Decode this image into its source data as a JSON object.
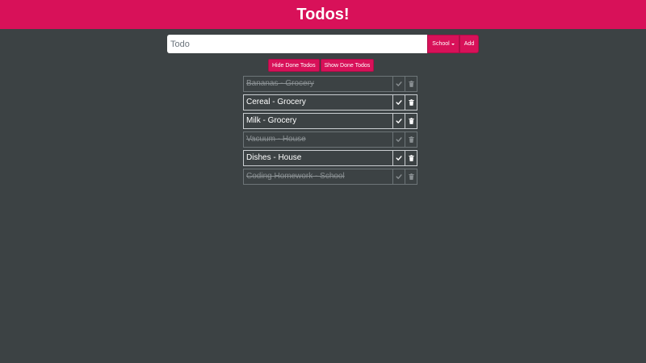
{
  "header": {
    "title": "Todos!"
  },
  "input": {
    "placeholder": "Todo",
    "category_label": "School",
    "add_label": "Add"
  },
  "filters": {
    "hide_label": "Hide Done Todos",
    "show_label": "Show Done Todos"
  },
  "todos": [
    {
      "text": "Bananas - Grocery",
      "done": true
    },
    {
      "text": "Cereal - Grocery",
      "done": false
    },
    {
      "text": "Milk - Grocery",
      "done": false
    },
    {
      "text": "Vacuum - House",
      "done": true
    },
    {
      "text": "Dishes - House",
      "done": false
    },
    {
      "text": "Coding Homework - School",
      "done": true
    }
  ],
  "icons": {
    "complete": "check-icon",
    "delete": "trash-icon"
  },
  "colors": {
    "accent": "#d81159",
    "background": "#3c4244",
    "done_text": "#8a9093"
  }
}
